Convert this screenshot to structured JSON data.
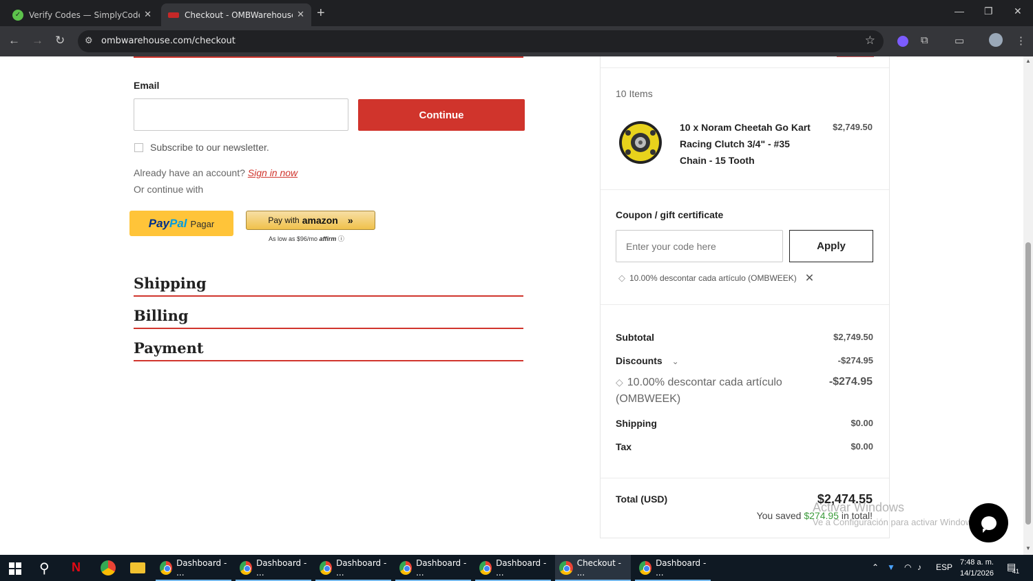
{
  "browser": {
    "tabs": [
      {
        "title": "Verify Codes — SimplyCodes",
        "active": false
      },
      {
        "title": "Checkout - OMBWarehouse.com",
        "active": true
      }
    ],
    "url": "ombwarehouse.com/checkout"
  },
  "checkout": {
    "email_label": "Email",
    "email_value": "",
    "continue_label": "Continue",
    "newsletter_label": "Subscribe to our newsletter.",
    "account_prompt": "Already have an account?",
    "sign_in_label": "Sign in now",
    "or_continue": "Or continue with",
    "paypal_word1": "Pay",
    "paypal_word2": "Pal",
    "paypal_pagar": "Pagar",
    "amazon_prefix": "Pay with",
    "amazon_brand": "amazon",
    "affirm_text": "As low as $96/mo",
    "affirm_brand": "affirm",
    "sections": [
      "Shipping",
      "Billing",
      "Payment"
    ]
  },
  "summary": {
    "items_count": "10 Items",
    "product_name": "10 x Noram Cheetah Go Kart Racing Clutch 3/4\" - #35 Chain - 15 Tooth",
    "product_price": "$2,749.50",
    "coupon_title": "Coupon / gift certificate",
    "coupon_placeholder": "Enter your code here",
    "apply_label": "Apply",
    "applied_coupon": "10.00% descontar cada artículo (OMBWEEK)",
    "subtotal_label": "Subtotal",
    "subtotal_value": "$2,749.50",
    "discounts_label": "Discounts",
    "discounts_value": "-$274.95",
    "discount_detail": "10.00% descontar cada artículo (OMBWEEK)",
    "discount_detail_value": "-$274.95",
    "shipping_label": "Shipping",
    "shipping_value": "$0.00",
    "tax_label": "Tax",
    "tax_value": "$0.00",
    "total_label": "Total (USD)",
    "total_value": "$2,474.55",
    "saved_prefix": "You saved",
    "saved_amount": "$274.95",
    "saved_suffix": "in total!"
  },
  "watermark": {
    "line1": "Activar Windows",
    "line2": "Ve a Configuración para activar Windows."
  },
  "taskbar": {
    "items": [
      "Dashboard - ...",
      "Dashboard - ...",
      "Dashboard - ...",
      "Dashboard - ...",
      "Dashboard - ...",
      "Checkout - ...",
      "Dashboard - ..."
    ],
    "lang": "ESP",
    "time": "7:48 a. m.",
    "date": "14/1/2026",
    "notif_count": "41"
  },
  "colors": {
    "brand_red": "#d0342c",
    "saved_green": "#3b9b3b"
  }
}
